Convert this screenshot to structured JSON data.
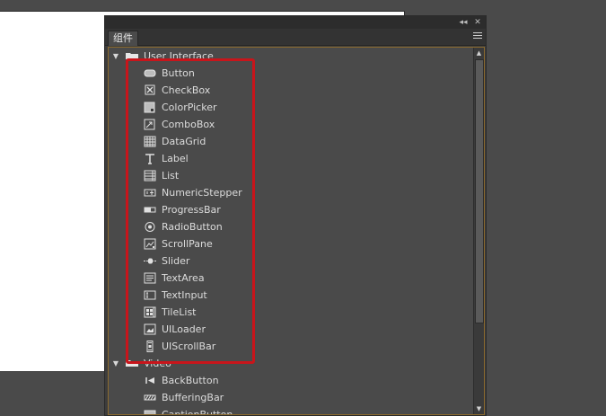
{
  "panel": {
    "tab_label": "组件",
    "collapse_glyph": "◂◂",
    "close_glyph": "✕"
  },
  "tree": {
    "groups": [
      {
        "label": "User Interface",
        "expanded": true,
        "items": [
          {
            "label": "Button",
            "icon": "button-icon"
          },
          {
            "label": "CheckBox",
            "icon": "checkbox-icon"
          },
          {
            "label": "ColorPicker",
            "icon": "colorpicker-icon"
          },
          {
            "label": "ComboBox",
            "icon": "combobox-icon"
          },
          {
            "label": "DataGrid",
            "icon": "datagrid-icon"
          },
          {
            "label": "Label",
            "icon": "label-icon"
          },
          {
            "label": "List",
            "icon": "list-icon"
          },
          {
            "label": "NumericStepper",
            "icon": "numericstepper-icon"
          },
          {
            "label": "ProgressBar",
            "icon": "progressbar-icon"
          },
          {
            "label": "RadioButton",
            "icon": "radiobutton-icon"
          },
          {
            "label": "ScrollPane",
            "icon": "scrollpane-icon"
          },
          {
            "label": "Slider",
            "icon": "slider-icon"
          },
          {
            "label": "TextArea",
            "icon": "textarea-icon"
          },
          {
            "label": "TextInput",
            "icon": "textinput-icon"
          },
          {
            "label": "TileList",
            "icon": "tilelist-icon"
          },
          {
            "label": "UILoader",
            "icon": "uiloader-icon"
          },
          {
            "label": "UIScrollBar",
            "icon": "uiscrollbar-icon"
          }
        ]
      },
      {
        "label": "Video",
        "expanded": true,
        "items": [
          {
            "label": "BackButton",
            "icon": "backbutton-icon"
          },
          {
            "label": "BufferingBar",
            "icon": "bufferingbar-icon"
          },
          {
            "label": "CaptionButton",
            "icon": "captionbutton-icon"
          }
        ]
      }
    ]
  },
  "colors": {
    "highlight": "#c8151b",
    "content_border": "#8b6a2e"
  }
}
